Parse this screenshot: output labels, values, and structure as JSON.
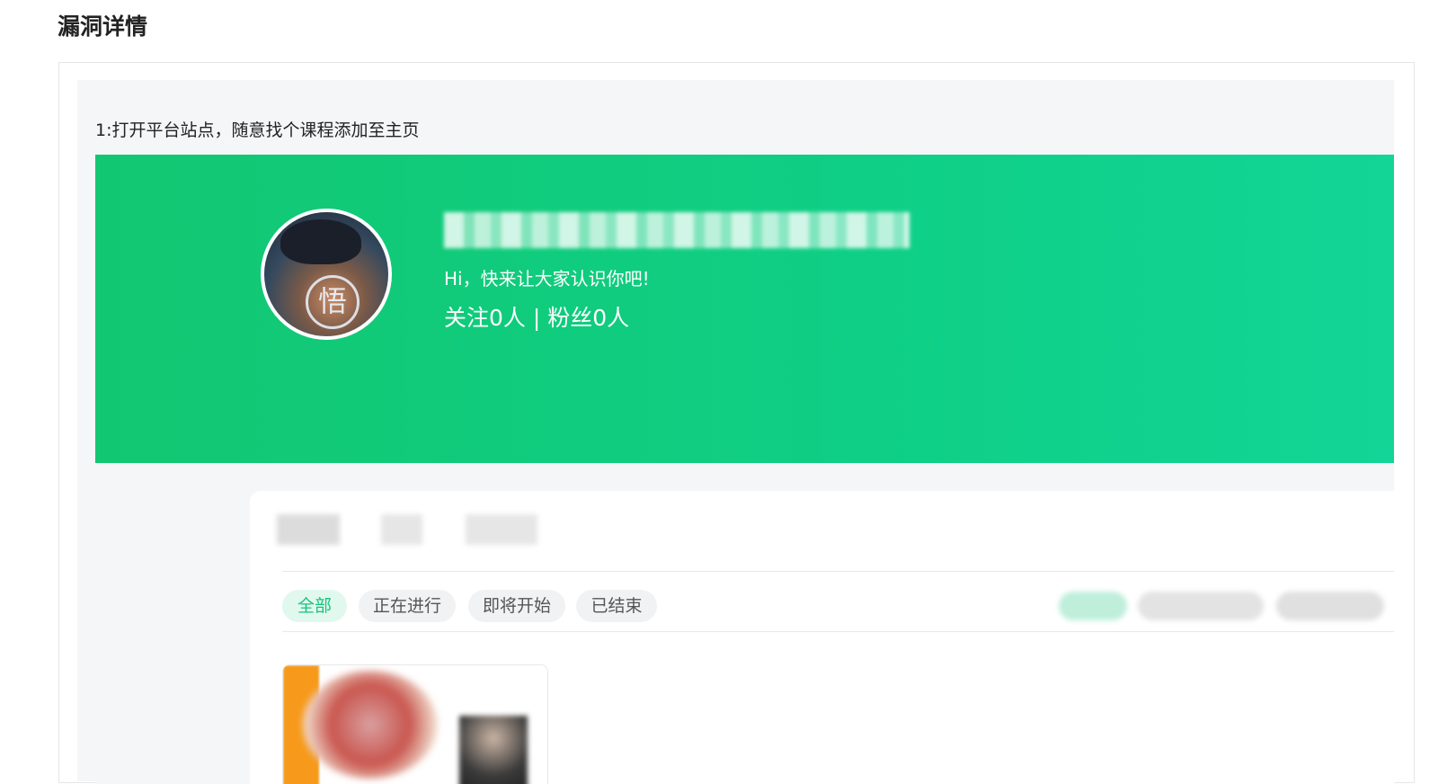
{
  "page_title": "漏洞详情",
  "step": {
    "text": "1:打开平台站点，随意找个课程添加至主页"
  },
  "profile": {
    "greeting": "Hi，快来让大家认识你吧!",
    "follow_stats": "关注0人 | 粉丝0人",
    "avatar_glyph": "悟"
  },
  "filters": [
    {
      "label": "全部",
      "active": true
    },
    {
      "label": "正在进行",
      "active": false
    },
    {
      "label": "即将开始",
      "active": false
    },
    {
      "label": "已结束",
      "active": false
    }
  ],
  "colors": {
    "banner": "#12c771",
    "active_filter_text": "#19c27b",
    "active_filter_bg": "#e1f8ee"
  }
}
